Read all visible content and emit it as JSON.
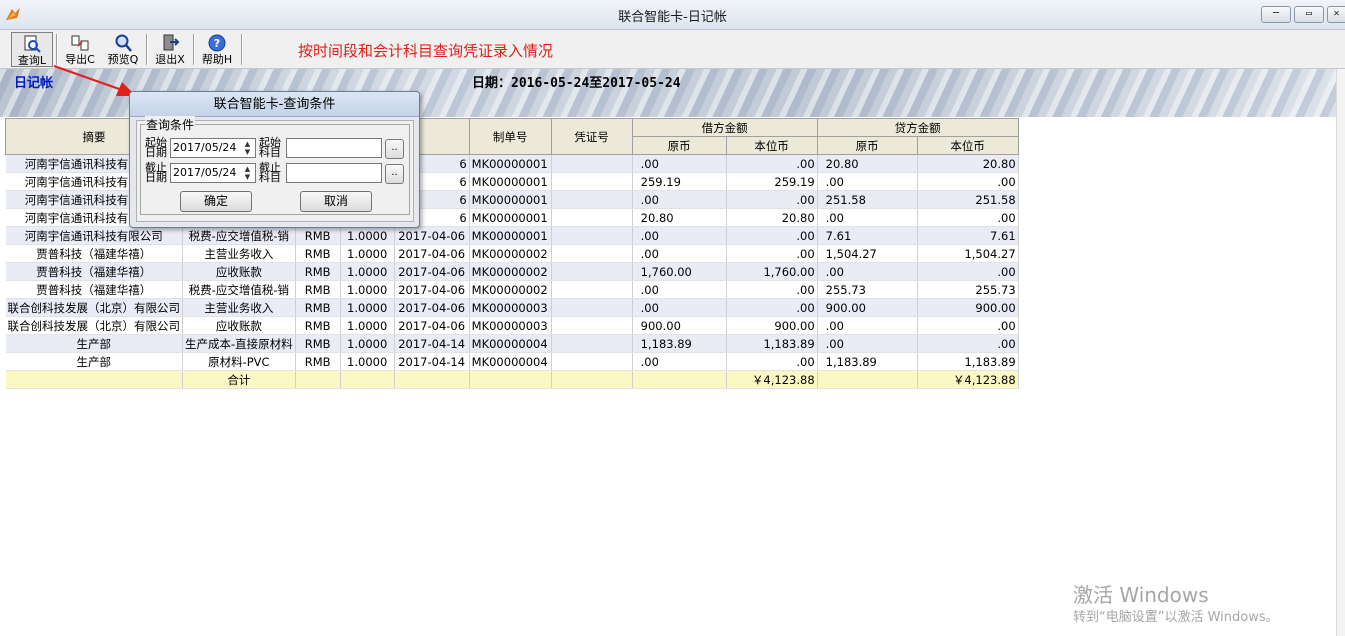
{
  "window": {
    "title": "联合智能卡-日记帐",
    "buttons": [
      "─",
      "▭",
      "✕"
    ]
  },
  "toolbar": {
    "items": [
      {
        "label": "查询L",
        "icon": "query-icon"
      },
      {
        "label": "导出C",
        "icon": "export-icon"
      },
      {
        "label": "预览Q",
        "icon": "preview-icon"
      },
      {
        "label": "退出X",
        "icon": "exit-icon"
      },
      {
        "label": "帮助H",
        "icon": "help-icon"
      }
    ],
    "annotation": "按时间段和会计科目查询凭证录入情况"
  },
  "banner": {
    "title": "日记帐",
    "date_range": "日期：2016-05-24至2017-05-24"
  },
  "table": {
    "headers": {
      "summary": "摘要",
      "maker_no": "制单号",
      "voucher_no": "凭证号",
      "debit": "借方金额",
      "credit": "贷方金额",
      "orig": "原币",
      "local": "本位币"
    },
    "rows": [
      {
        "summary": "河南宇信通讯科技有限公司",
        "subject": "",
        "cur": "",
        "rate": "",
        "date": "6",
        "no": "MK00000001",
        "vno": "",
        "d_orig": ".00",
        "d_local": ".00",
        "c_orig": "20.80",
        "c_local": "20.80"
      },
      {
        "summary": "河南宇信通讯科技有限公司",
        "subject": "",
        "cur": "",
        "rate": "",
        "date": "6",
        "no": "MK00000001",
        "vno": "",
        "d_orig": "259.19",
        "d_local": "259.19",
        "c_orig": ".00",
        "c_local": ".00"
      },
      {
        "summary": "河南宇信通讯科技有限公司",
        "subject": "",
        "cur": "",
        "rate": "",
        "date": "6",
        "no": "MK00000001",
        "vno": "",
        "d_orig": ".00",
        "d_local": ".00",
        "c_orig": "251.58",
        "c_local": "251.58"
      },
      {
        "summary": "河南宇信通讯科技有限公司",
        "subject": "",
        "cur": "",
        "rate": "",
        "date": "6",
        "no": "MK00000001",
        "vno": "",
        "d_orig": "20.80",
        "d_local": "20.80",
        "c_orig": ".00",
        "c_local": ".00"
      },
      {
        "summary": "河南宇信通讯科技有限公司",
        "subject": "税费-应交增值税-销",
        "cur": "RMB",
        "rate": "1.0000",
        "date": "2017-04-06",
        "no": "MK00000001",
        "vno": "",
        "d_orig": ".00",
        "d_local": ".00",
        "c_orig": "7.61",
        "c_local": "7.61"
      },
      {
        "summary": "贾普科技（福建华禧）",
        "subject": "主营业务收入",
        "cur": "RMB",
        "rate": "1.0000",
        "date": "2017-04-06",
        "no": "MK00000002",
        "vno": "",
        "d_orig": ".00",
        "d_local": ".00",
        "c_orig": "1,504.27",
        "c_local": "1,504.27"
      },
      {
        "summary": "贾普科技（福建华禧）",
        "subject": "应收账款",
        "cur": "RMB",
        "rate": "1.0000",
        "date": "2017-04-06",
        "no": "MK00000002",
        "vno": "",
        "d_orig": "1,760.00",
        "d_local": "1,760.00",
        "c_orig": ".00",
        "c_local": ".00"
      },
      {
        "summary": "贾普科技（福建华禧）",
        "subject": "税费-应交增值税-销",
        "cur": "RMB",
        "rate": "1.0000",
        "date": "2017-04-06",
        "no": "MK00000002",
        "vno": "",
        "d_orig": ".00",
        "d_local": ".00",
        "c_orig": "255.73",
        "c_local": "255.73"
      },
      {
        "summary": "联合创科技发展（北京）有限公司",
        "subject": "主营业务收入",
        "cur": "RMB",
        "rate": "1.0000",
        "date": "2017-04-06",
        "no": "MK00000003",
        "vno": "",
        "d_orig": ".00",
        "d_local": ".00",
        "c_orig": "900.00",
        "c_local": "900.00"
      },
      {
        "summary": "联合创科技发展（北京）有限公司",
        "subject": "应收账款",
        "cur": "RMB",
        "rate": "1.0000",
        "date": "2017-04-06",
        "no": "MK00000003",
        "vno": "",
        "d_orig": "900.00",
        "d_local": "900.00",
        "c_orig": ".00",
        "c_local": ".00"
      },
      {
        "summary": "生产部",
        "subject": "生产成本-直接原材料",
        "cur": "RMB",
        "rate": "1.0000",
        "date": "2017-04-14",
        "no": "MK00000004",
        "vno": "",
        "d_orig": "1,183.89",
        "d_local": "1,183.89",
        "c_orig": ".00",
        "c_local": ".00"
      },
      {
        "summary": "生产部",
        "subject": "原材料-PVC",
        "cur": "RMB",
        "rate": "1.0000",
        "date": "2017-04-14",
        "no": "MK00000004",
        "vno": "",
        "d_orig": ".00",
        "d_local": ".00",
        "c_orig": "1,183.89",
        "c_local": "1,183.89"
      }
    ],
    "total": {
      "label": "合计",
      "debit_local": "￥4,123.88",
      "credit_local": "￥4,123.88"
    }
  },
  "dialog": {
    "title": "联合智能卡-查询条件",
    "group_label": "查询条件",
    "start_date_label": "起始日期",
    "end_date_label": "截止日期",
    "start_subject_label": "起始科目",
    "end_subject_label": "截止科目",
    "start_date": "2017/05/24",
    "end_date": "2017/05/24",
    "start_subject": "",
    "end_subject": "",
    "pick_label": "..",
    "ok": "确定",
    "cancel": "取消"
  },
  "watermark": {
    "line1": "激活 Windows",
    "line2": "转到“电脑设置”以激活 Windows。"
  },
  "colors": {
    "annotation": "#e0201a",
    "banner_title": "#0018c8",
    "row_alt": "#e9ecf7",
    "total_row": "#fbf8c4"
  }
}
